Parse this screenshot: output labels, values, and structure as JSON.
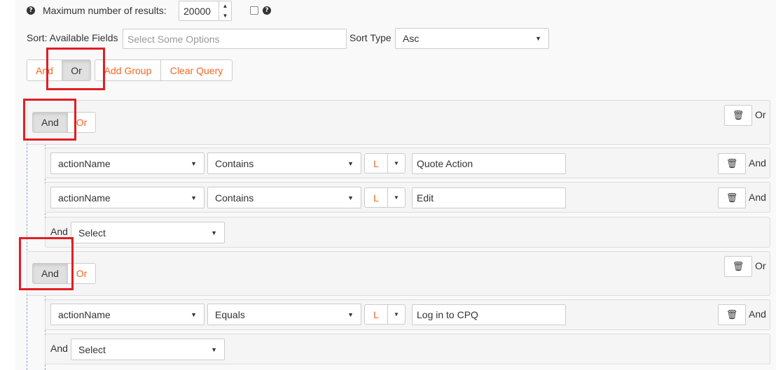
{
  "max_results": {
    "label": "Maximum number of results:",
    "value": "20000"
  },
  "sort": {
    "label": "Sort: Available Fields",
    "placeholder": "Select Some Options",
    "type_label": "Sort Type",
    "type_value": "Asc"
  },
  "top_buttons": {
    "and": "And",
    "or": "Or",
    "add_group": "Add Group",
    "clear_query": "Clear Query"
  },
  "groups": [
    {
      "and": "And",
      "or": "Or",
      "join_label": "Or",
      "rules": [
        {
          "field": "actionName",
          "operator": "Contains",
          "l": "L",
          "value": "Quote Action",
          "join": "And"
        },
        {
          "field": "actionName",
          "operator": "Contains",
          "l": "L",
          "value": "Edit",
          "join": "And"
        }
      ],
      "add_row": {
        "label": "And",
        "select": "Select"
      }
    },
    {
      "and": "And",
      "or": "Or",
      "join_label": "Or",
      "rules": [
        {
          "field": "actionName",
          "operator": "Equals",
          "l": "L",
          "value": "Log in to CPQ",
          "join": "And"
        }
      ],
      "add_row": {
        "label": "And",
        "select": "Select"
      }
    }
  ],
  "colors": {
    "accent": "#f26722",
    "highlight_box": "#e21d24"
  },
  "icons": [
    "help-icon",
    "trash-icon",
    "chevron-down-icon",
    "caret-down-icon",
    "spinner-up-icon",
    "spinner-down-icon"
  ]
}
